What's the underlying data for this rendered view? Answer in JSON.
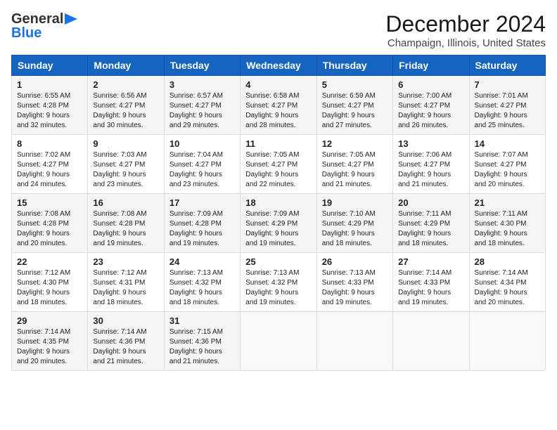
{
  "header": {
    "logo_line1": "General",
    "logo_line2": "Blue",
    "month": "December 2024",
    "location": "Champaign, Illinois, United States"
  },
  "columns": [
    "Sunday",
    "Monday",
    "Tuesday",
    "Wednesday",
    "Thursday",
    "Friday",
    "Saturday"
  ],
  "weeks": [
    [
      {
        "day": "1",
        "sunrise": "Sunrise: 6:55 AM",
        "sunset": "Sunset: 4:28 PM",
        "daylight": "Daylight: 9 hours and 32 minutes."
      },
      {
        "day": "2",
        "sunrise": "Sunrise: 6:56 AM",
        "sunset": "Sunset: 4:27 PM",
        "daylight": "Daylight: 9 hours and 30 minutes."
      },
      {
        "day": "3",
        "sunrise": "Sunrise: 6:57 AM",
        "sunset": "Sunset: 4:27 PM",
        "daylight": "Daylight: 9 hours and 29 minutes."
      },
      {
        "day": "4",
        "sunrise": "Sunrise: 6:58 AM",
        "sunset": "Sunset: 4:27 PM",
        "daylight": "Daylight: 9 hours and 28 minutes."
      },
      {
        "day": "5",
        "sunrise": "Sunrise: 6:59 AM",
        "sunset": "Sunset: 4:27 PM",
        "daylight": "Daylight: 9 hours and 27 minutes."
      },
      {
        "day": "6",
        "sunrise": "Sunrise: 7:00 AM",
        "sunset": "Sunset: 4:27 PM",
        "daylight": "Daylight: 9 hours and 26 minutes."
      },
      {
        "day": "7",
        "sunrise": "Sunrise: 7:01 AM",
        "sunset": "Sunset: 4:27 PM",
        "daylight": "Daylight: 9 hours and 25 minutes."
      }
    ],
    [
      {
        "day": "8",
        "sunrise": "Sunrise: 7:02 AM",
        "sunset": "Sunset: 4:27 PM",
        "daylight": "Daylight: 9 hours and 24 minutes."
      },
      {
        "day": "9",
        "sunrise": "Sunrise: 7:03 AM",
        "sunset": "Sunset: 4:27 PM",
        "daylight": "Daylight: 9 hours and 23 minutes."
      },
      {
        "day": "10",
        "sunrise": "Sunrise: 7:04 AM",
        "sunset": "Sunset: 4:27 PM",
        "daylight": "Daylight: 9 hours and 23 minutes."
      },
      {
        "day": "11",
        "sunrise": "Sunrise: 7:05 AM",
        "sunset": "Sunset: 4:27 PM",
        "daylight": "Daylight: 9 hours and 22 minutes."
      },
      {
        "day": "12",
        "sunrise": "Sunrise: 7:05 AM",
        "sunset": "Sunset: 4:27 PM",
        "daylight": "Daylight: 9 hours and 21 minutes."
      },
      {
        "day": "13",
        "sunrise": "Sunrise: 7:06 AM",
        "sunset": "Sunset: 4:27 PM",
        "daylight": "Daylight: 9 hours and 21 minutes."
      },
      {
        "day": "14",
        "sunrise": "Sunrise: 7:07 AM",
        "sunset": "Sunset: 4:27 PM",
        "daylight": "Daylight: 9 hours and 20 minutes."
      }
    ],
    [
      {
        "day": "15",
        "sunrise": "Sunrise: 7:08 AM",
        "sunset": "Sunset: 4:28 PM",
        "daylight": "Daylight: 9 hours and 20 minutes."
      },
      {
        "day": "16",
        "sunrise": "Sunrise: 7:08 AM",
        "sunset": "Sunset: 4:28 PM",
        "daylight": "Daylight: 9 hours and 19 minutes."
      },
      {
        "day": "17",
        "sunrise": "Sunrise: 7:09 AM",
        "sunset": "Sunset: 4:28 PM",
        "daylight": "Daylight: 9 hours and 19 minutes."
      },
      {
        "day": "18",
        "sunrise": "Sunrise: 7:09 AM",
        "sunset": "Sunset: 4:29 PM",
        "daylight": "Daylight: 9 hours and 19 minutes."
      },
      {
        "day": "19",
        "sunrise": "Sunrise: 7:10 AM",
        "sunset": "Sunset: 4:29 PM",
        "daylight": "Daylight: 9 hours and 18 minutes."
      },
      {
        "day": "20",
        "sunrise": "Sunrise: 7:11 AM",
        "sunset": "Sunset: 4:29 PM",
        "daylight": "Daylight: 9 hours and 18 minutes."
      },
      {
        "day": "21",
        "sunrise": "Sunrise: 7:11 AM",
        "sunset": "Sunset: 4:30 PM",
        "daylight": "Daylight: 9 hours and 18 minutes."
      }
    ],
    [
      {
        "day": "22",
        "sunrise": "Sunrise: 7:12 AM",
        "sunset": "Sunset: 4:30 PM",
        "daylight": "Daylight: 9 hours and 18 minutes."
      },
      {
        "day": "23",
        "sunrise": "Sunrise: 7:12 AM",
        "sunset": "Sunset: 4:31 PM",
        "daylight": "Daylight: 9 hours and 18 minutes."
      },
      {
        "day": "24",
        "sunrise": "Sunrise: 7:13 AM",
        "sunset": "Sunset: 4:32 PM",
        "daylight": "Daylight: 9 hours and 18 minutes."
      },
      {
        "day": "25",
        "sunrise": "Sunrise: 7:13 AM",
        "sunset": "Sunset: 4:32 PM",
        "daylight": "Daylight: 9 hours and 19 minutes."
      },
      {
        "day": "26",
        "sunrise": "Sunrise: 7:13 AM",
        "sunset": "Sunset: 4:33 PM",
        "daylight": "Daylight: 9 hours and 19 minutes."
      },
      {
        "day": "27",
        "sunrise": "Sunrise: 7:14 AM",
        "sunset": "Sunset: 4:33 PM",
        "daylight": "Daylight: 9 hours and 19 minutes."
      },
      {
        "day": "28",
        "sunrise": "Sunrise: 7:14 AM",
        "sunset": "Sunset: 4:34 PM",
        "daylight": "Daylight: 9 hours and 20 minutes."
      }
    ],
    [
      {
        "day": "29",
        "sunrise": "Sunrise: 7:14 AM",
        "sunset": "Sunset: 4:35 PM",
        "daylight": "Daylight: 9 hours and 20 minutes."
      },
      {
        "day": "30",
        "sunrise": "Sunrise: 7:14 AM",
        "sunset": "Sunset: 4:36 PM",
        "daylight": "Daylight: 9 hours and 21 minutes."
      },
      {
        "day": "31",
        "sunrise": "Sunrise: 7:15 AM",
        "sunset": "Sunset: 4:36 PM",
        "daylight": "Daylight: 9 hours and 21 minutes."
      },
      null,
      null,
      null,
      null
    ]
  ]
}
